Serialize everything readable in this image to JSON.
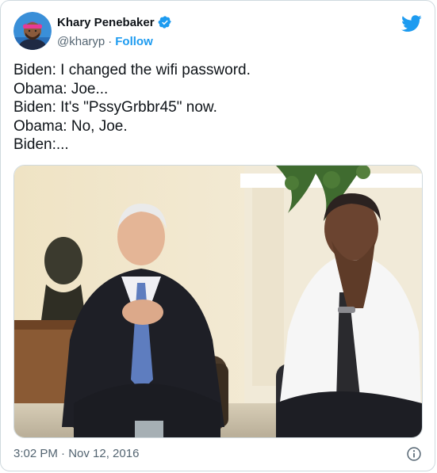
{
  "user": {
    "name": "Khary Penebaker",
    "handle": "@kharyp",
    "follow_label": "Follow",
    "separator": "·",
    "avatar_icon": "avatar-photo",
    "verified_icon": "verified-badge-icon"
  },
  "tweet": {
    "lines": [
      "Biden: I changed the wifi password.",
      "Obama: Joe...",
      "Biden: It's \"PssyGrbbr45\" now.",
      "Obama: No, Joe.",
      "Biden:..."
    ],
    "timestamp": "3:02 PM · Nov 12, 2016"
  },
  "media": {
    "alt": "photo of two men seated in an office"
  },
  "colors": {
    "accent": "#1d9bf0",
    "text": "#0f1419",
    "muted": "#536471",
    "border": "#cfd9de"
  },
  "icons": {
    "logo": "twitter-bird-icon",
    "info": "info-icon"
  }
}
